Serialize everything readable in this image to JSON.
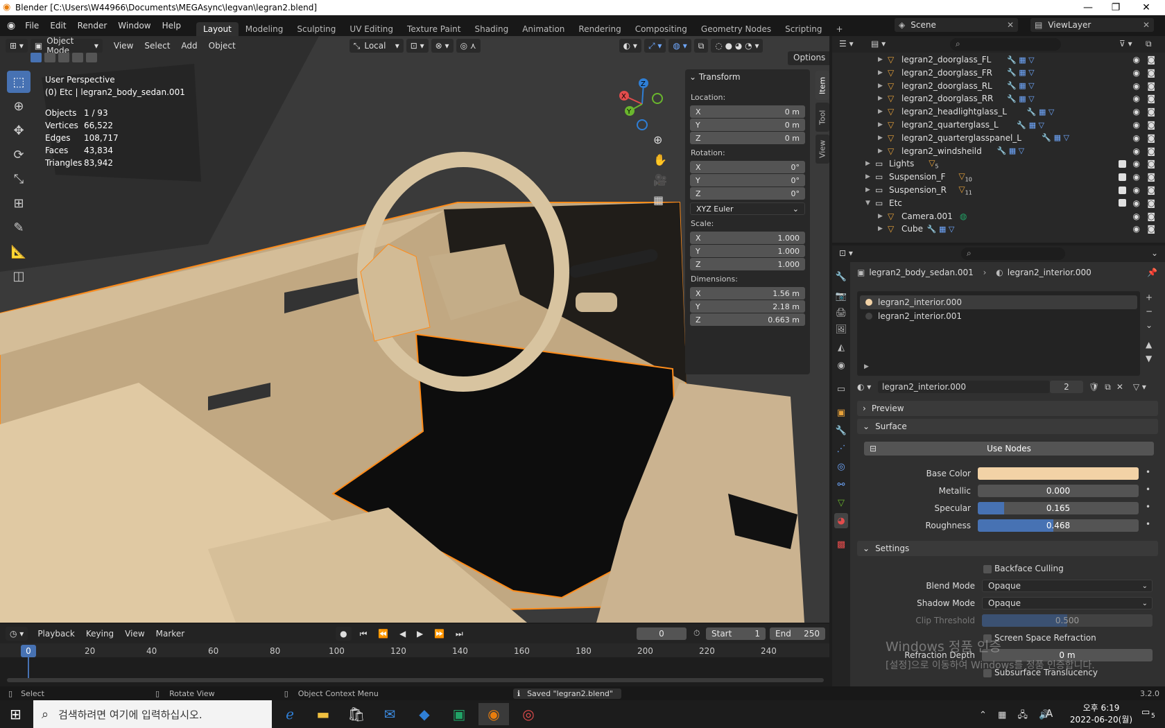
{
  "window": {
    "title": "Blender [C:\\Users\\W44966\\Documents\\MEGAsync\\legvan\\legran2.blend]",
    "minimize": "—",
    "maximize": "❐",
    "close": "✕"
  },
  "menubar": {
    "items": [
      "File",
      "Edit",
      "Render",
      "Window",
      "Help"
    ]
  },
  "workspaces": {
    "active": "Layout",
    "tabs": [
      "Layout",
      "Modeling",
      "Sculpting",
      "UV Editing",
      "Texture Paint",
      "Shading",
      "Animation",
      "Rendering",
      "Compositing",
      "Geometry Nodes",
      "Scripting"
    ],
    "add": "+"
  },
  "scene": {
    "label": "Scene",
    "viewlayer": "ViewLayer"
  },
  "viewport_header": {
    "mode": "Object Mode",
    "menus": [
      "View",
      "Select",
      "Add",
      "Object"
    ],
    "orientation": "Local",
    "options": "Options"
  },
  "viewport_overlay": {
    "perspective": "User Perspective",
    "context": "(0) Etc | legran2_body_sedan.001",
    "stats": [
      {
        "k": "Objects",
        "v": "1 / 93"
      },
      {
        "k": "Vertices",
        "v": "66,522"
      },
      {
        "k": "Edges",
        "v": "108,717"
      },
      {
        "k": "Faces",
        "v": "43,834"
      },
      {
        "k": "Triangles",
        "v": "83,942"
      }
    ]
  },
  "gizmo": {
    "x": "X",
    "y": "Y",
    "z": "Z"
  },
  "transform": {
    "header": "Transform",
    "location_label": "Location:",
    "location": [
      {
        "ax": "X",
        "v": "0 m"
      },
      {
        "ax": "Y",
        "v": "0 m"
      },
      {
        "ax": "Z",
        "v": "0 m"
      }
    ],
    "rotation_label": "Rotation:",
    "rotation": [
      {
        "ax": "X",
        "v": "0°"
      },
      {
        "ax": "Y",
        "v": "0°"
      },
      {
        "ax": "Z",
        "v": "0°"
      }
    ],
    "rotation_mode": "XYZ Euler",
    "scale_label": "Scale:",
    "scale": [
      {
        "ax": "X",
        "v": "1.000"
      },
      {
        "ax": "Y",
        "v": "1.000"
      },
      {
        "ax": "Z",
        "v": "1.000"
      }
    ],
    "dimensions_label": "Dimensions:",
    "dimensions": [
      {
        "ax": "X",
        "v": "1.56 m"
      },
      {
        "ax": "Y",
        "v": "2.18 m"
      },
      {
        "ax": "Z",
        "v": "0.663 m"
      }
    ]
  },
  "side_tabs": [
    "Item",
    "Tool",
    "View"
  ],
  "timeline": {
    "menus": [
      "Playback",
      "Keying",
      "View",
      "Marker"
    ],
    "current_frame": "0",
    "start_label": "Start",
    "start": "1",
    "end_label": "End",
    "end": "250",
    "ticks": [
      "0",
      "20",
      "40",
      "60",
      "80",
      "100",
      "120",
      "140",
      "160",
      "180",
      "200",
      "220",
      "240"
    ]
  },
  "outliner": {
    "rows": [
      {
        "name": "legran2_doorglass_FL",
        "kind": "mesh"
      },
      {
        "name": "legran2_doorglass_FR",
        "kind": "mesh"
      },
      {
        "name": "legran2_doorglass_RL",
        "kind": "mesh"
      },
      {
        "name": "legran2_doorglass_RR",
        "kind": "mesh"
      },
      {
        "name": "legran2_headlightglass_L",
        "kind": "mesh"
      },
      {
        "name": "legran2_quarterglass_L",
        "kind": "mesh"
      },
      {
        "name": "legran2_quarterglasspanel_L",
        "kind": "mesh"
      },
      {
        "name": "legran2_windsheild",
        "kind": "mesh"
      },
      {
        "name": "Lights",
        "kind": "collection",
        "badge": "5"
      },
      {
        "name": "Suspension_F",
        "kind": "collection",
        "badge": "10"
      },
      {
        "name": "Suspension_R",
        "kind": "collection",
        "badge": "11"
      },
      {
        "name": "Etc",
        "kind": "collection"
      },
      {
        "name": "Camera.001",
        "kind": "camera"
      },
      {
        "name": "Cube",
        "kind": "mesh"
      }
    ]
  },
  "properties": {
    "breadcrumb_object": "legran2_body_sedan.001",
    "breadcrumb_material": "legran2_interior.000",
    "slots": [
      "legran2_interior.000",
      "legran2_interior.001"
    ],
    "material_name": "legran2_interior.000",
    "users": "2",
    "preview": "Preview",
    "surface": "Surface",
    "use_nodes": "Use Nodes",
    "base_color_label": "Base Color",
    "base_color": "#f2d2a6",
    "metallic_label": "Metallic",
    "metallic": "0.000",
    "metallic_fraction": 0,
    "specular_label": "Specular",
    "specular": "0.165",
    "specular_fraction": 0.165,
    "roughness_label": "Roughness",
    "roughness": "0.468",
    "roughness_fraction": 0.468,
    "settings": "Settings",
    "backface": "Backface Culling",
    "blend_label": "Blend Mode",
    "blend": "Opaque",
    "shadow_label": "Shadow Mode",
    "shadow": "Opaque",
    "clip_label": "Clip Threshold",
    "clip": "0.500",
    "clip_fraction": 0.5,
    "ssr": "Screen Space Refraction",
    "refr_label": "Refraction Depth",
    "refr": "0 m",
    "sss": "Subsurface Translucency"
  },
  "statusbar": {
    "select": "Select",
    "rotate": "Rotate View",
    "context": "Object Context Menu",
    "saved": "Saved \"legran2.blend\"",
    "version": "3.2.0"
  },
  "watermark": {
    "line1": "Windows 정품 인증",
    "line2": "[설정]으로 이동하여 Windows를 정품 인증합니다."
  },
  "taskbar": {
    "search_placeholder": "검색하려면 여기에 입력하십시오.",
    "time": "오후 6:19",
    "date": "2022-06-20(월)",
    "ime": "A",
    "notif": "5"
  }
}
